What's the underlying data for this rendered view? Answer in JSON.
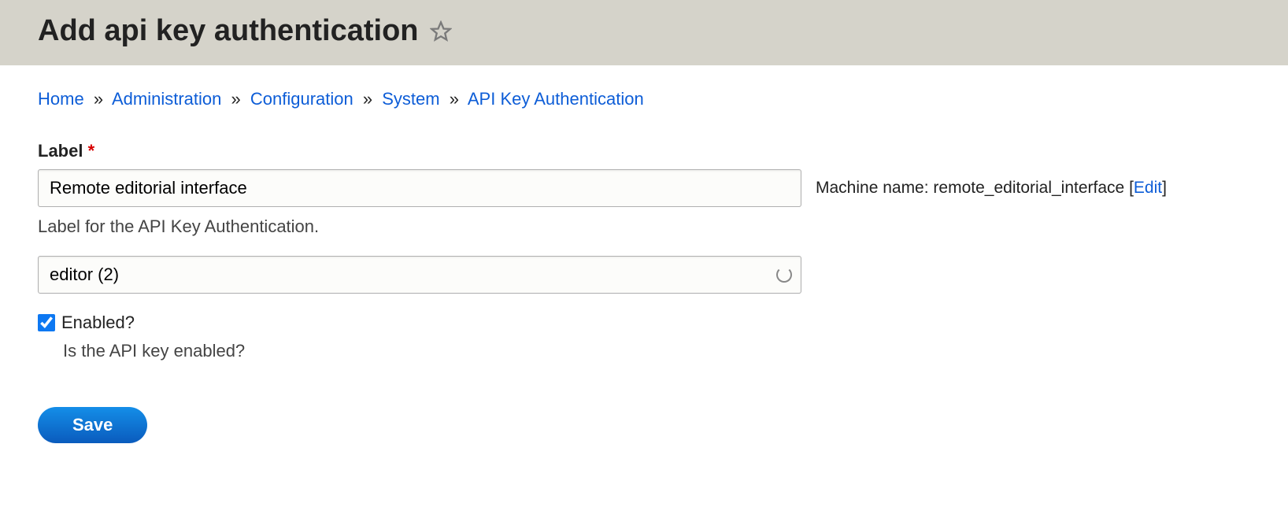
{
  "header": {
    "title": "Add api key authentication"
  },
  "breadcrumb": {
    "items": [
      {
        "label": "Home"
      },
      {
        "label": "Administration"
      },
      {
        "label": "Configuration"
      },
      {
        "label": "System"
      },
      {
        "label": "API Key Authentication"
      }
    ],
    "separator": "»"
  },
  "form": {
    "label_field": {
      "label": "Label",
      "required_mark": "*",
      "value": "Remote editorial interface",
      "description": "Label for the API Key Authentication."
    },
    "machine_name": {
      "prefix": "Machine name: ",
      "value": "remote_editorial_interface",
      "edit_open": " [",
      "edit_label": "Edit",
      "edit_close": "]"
    },
    "user_field": {
      "value": "editor (2)"
    },
    "enabled": {
      "label": "Enabled?",
      "checked": true,
      "description": "Is the API key enabled?"
    },
    "submit": {
      "label": "Save"
    }
  }
}
